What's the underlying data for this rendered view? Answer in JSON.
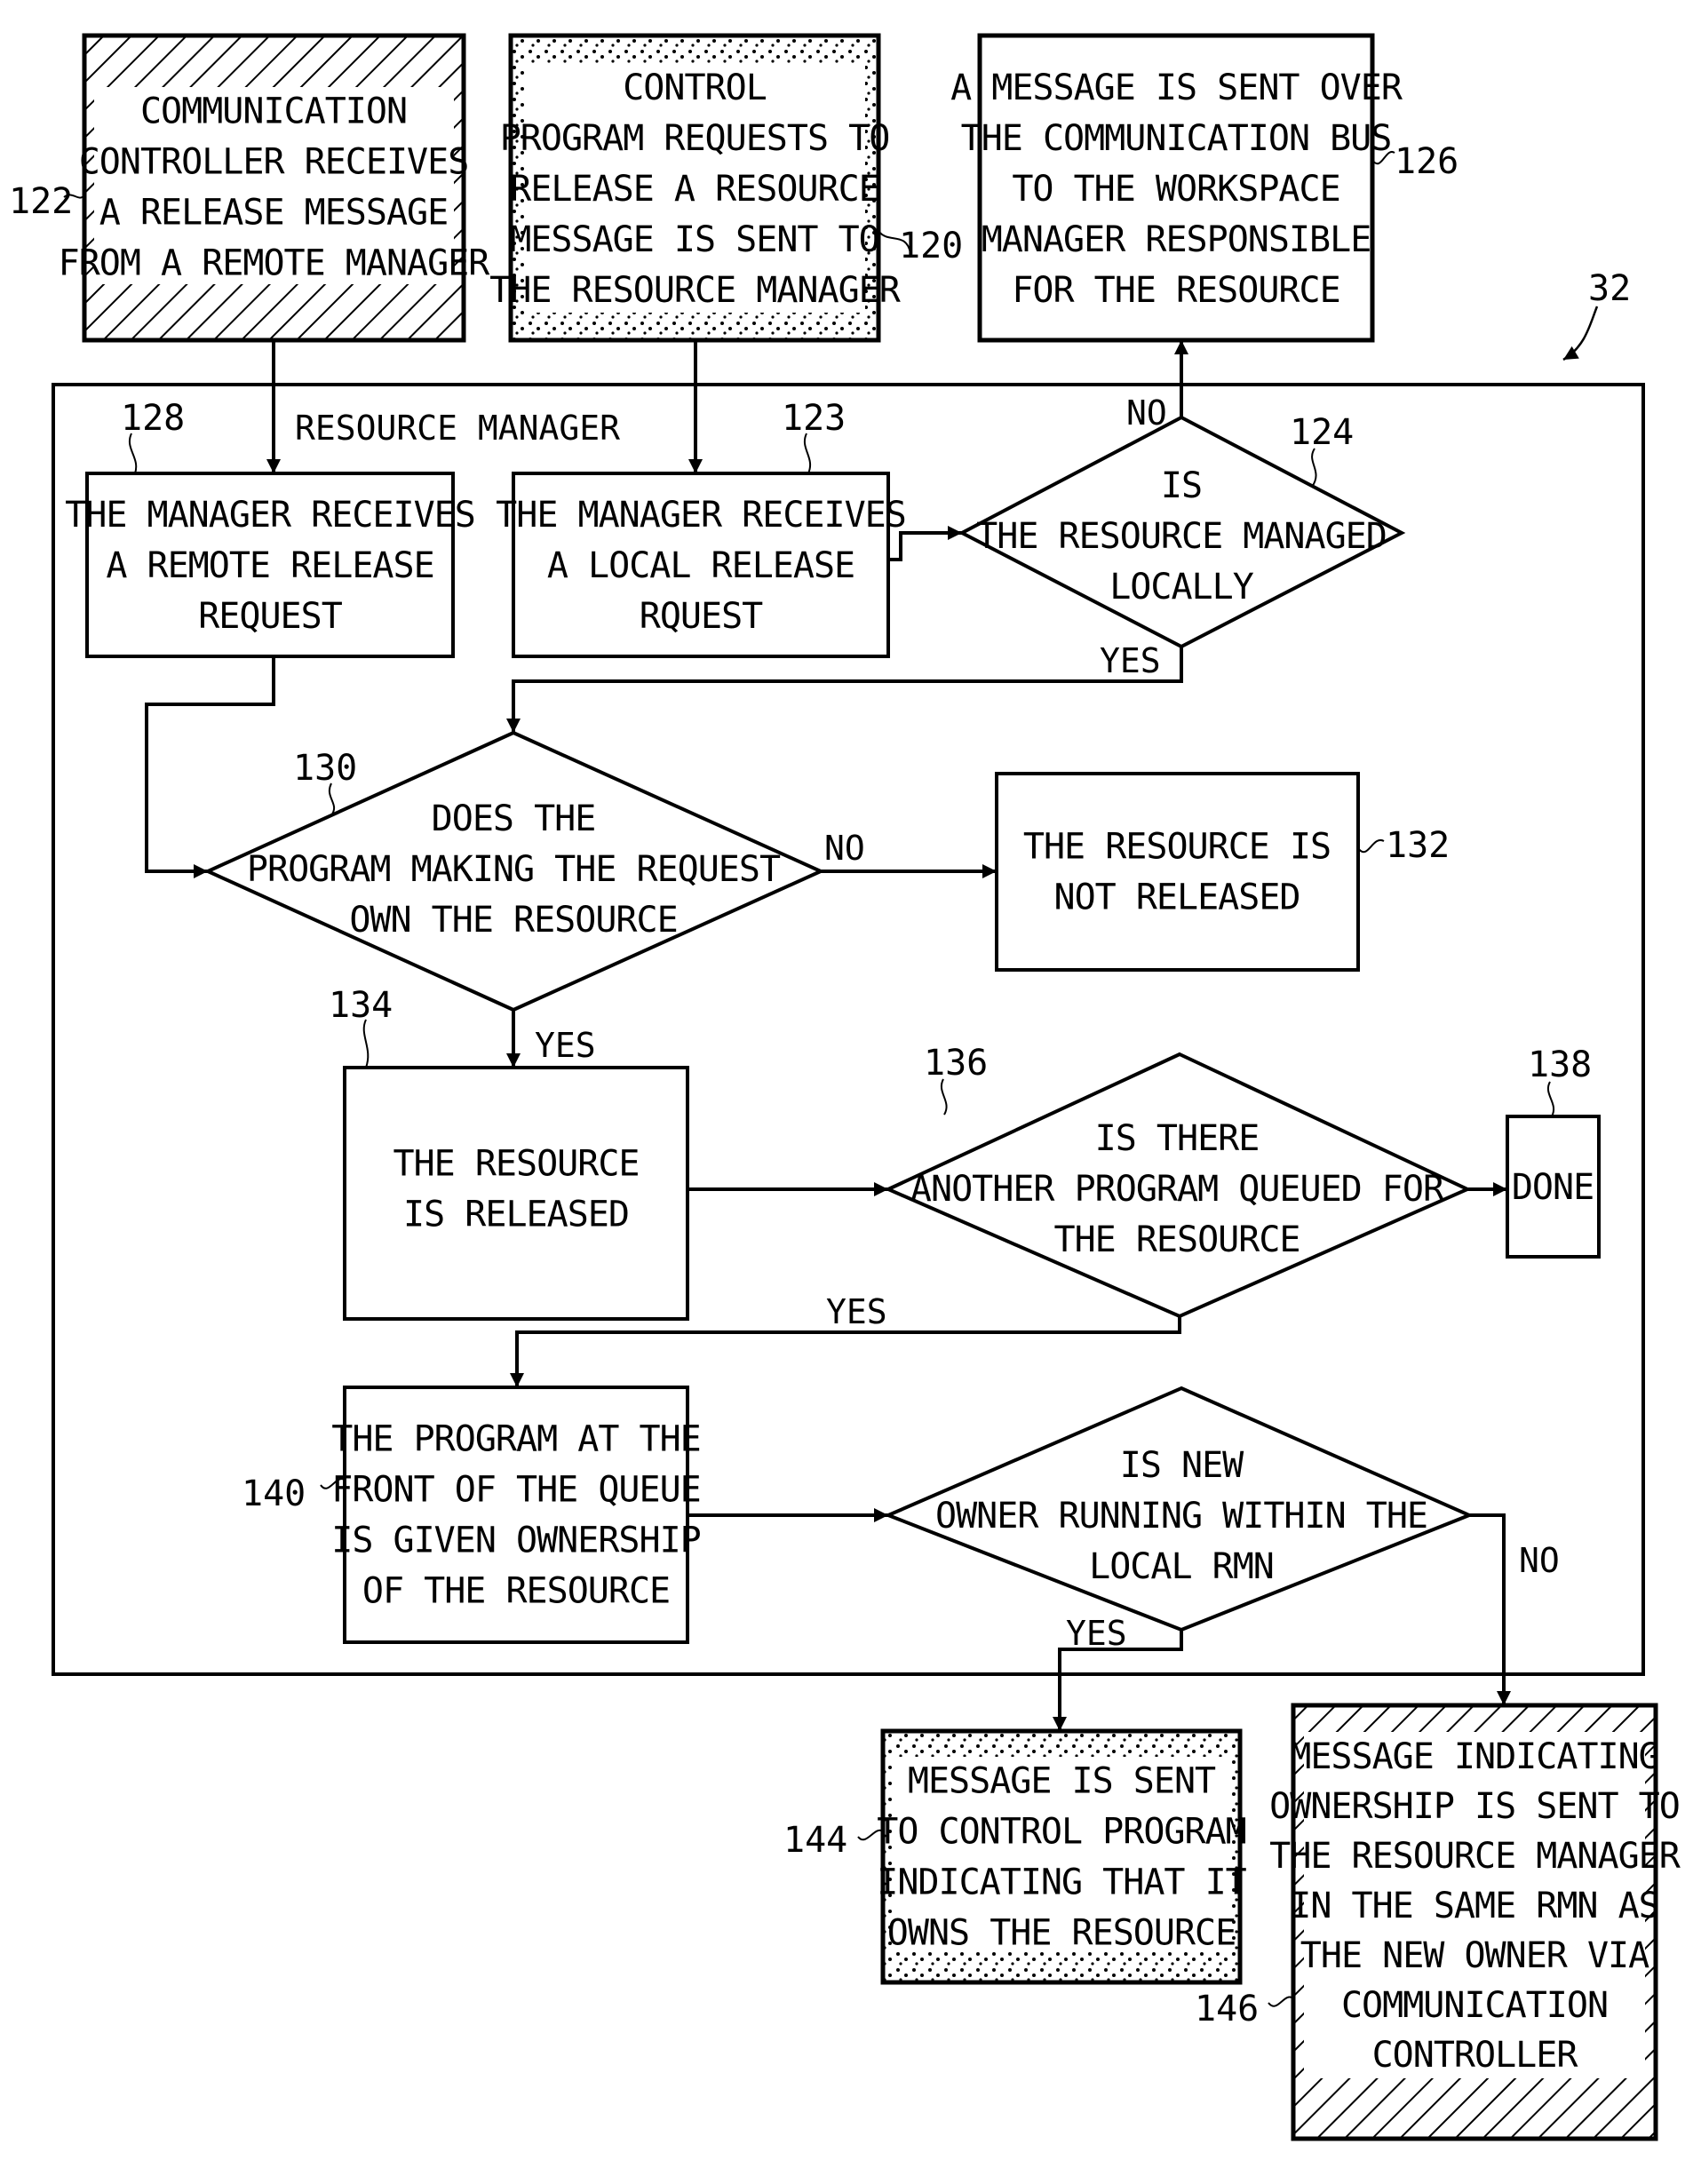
{
  "figure_ref": "32",
  "container": {
    "ref": "",
    "label": "RESOURCE MANAGER"
  },
  "nodes": [
    {
      "id": "122",
      "type": "process",
      "fill": "hatch",
      "ref": "122",
      "lines": [
        "COMMUNICATION",
        "CONTROLLER RECEIVES",
        "A RELEASE MESSAGE",
        "FROM A REMOTE MANAGER"
      ]
    },
    {
      "id": "120",
      "type": "process",
      "fill": "stipple",
      "ref": "120",
      "lines": [
        "CONTROL",
        "PROGRAM REQUESTS TO",
        "RELEASE A RESOURCE",
        "MESSAGE IS SENT TO",
        "THE RESOURCE MANAGER"
      ]
    },
    {
      "id": "126",
      "type": "process",
      "fill": "plain",
      "ref": "126",
      "lines": [
        "A MESSAGE IS SENT OVER",
        "THE COMMUNICATION BUS",
        "TO THE WORKSPACE",
        "MANAGER RESPONSIBLE",
        "FOR THE RESOURCE"
      ]
    },
    {
      "id": "128",
      "type": "process",
      "fill": "plain",
      "ref": "128",
      "lines": [
        "THE MANAGER RECEIVES",
        "A REMOTE RELEASE",
        "REQUEST"
      ]
    },
    {
      "id": "123",
      "type": "process",
      "fill": "plain",
      "ref": "123",
      "lines": [
        "THE MANAGER RECEIVES",
        "A LOCAL RELEASE",
        "RQUEST"
      ]
    },
    {
      "id": "124",
      "type": "decision",
      "ref": "124",
      "lines": [
        "IS",
        "THE RESOURCE MANAGED",
        "LOCALLY"
      ]
    },
    {
      "id": "130",
      "type": "decision",
      "ref": "130",
      "lines": [
        "DOES THE",
        "PROGRAM MAKING THE REQUEST",
        "OWN THE RESOURCE"
      ]
    },
    {
      "id": "132",
      "type": "process",
      "fill": "plain",
      "ref": "132",
      "lines": [
        "THE RESOURCE IS",
        "NOT RELEASED"
      ]
    },
    {
      "id": "134",
      "type": "process",
      "fill": "plain",
      "ref": "134",
      "lines": [
        "THE RESOURCE",
        "IS RELEASED"
      ]
    },
    {
      "id": "136",
      "type": "decision",
      "ref": "136",
      "lines": [
        "IS THERE",
        "ANOTHER PROGRAM QUEUED FOR",
        "THE RESOURCE"
      ]
    },
    {
      "id": "138",
      "type": "terminal",
      "fill": "plain",
      "ref": "138",
      "lines": [
        "DONE"
      ]
    },
    {
      "id": "140",
      "type": "process",
      "fill": "plain",
      "ref": "140",
      "lines": [
        "THE PROGRAM AT THE",
        "FRONT OF THE QUEUE",
        "IS GIVEN OWNERSHIP",
        "OF THE  RESOURCE"
      ]
    },
    {
      "id": "142",
      "type": "decision",
      "ref": "",
      "lines": [
        "IS NEW",
        "OWNER RUNNING WITHIN THE",
        "LOCAL RMN"
      ]
    },
    {
      "id": "144",
      "type": "process",
      "fill": "stipple",
      "ref": "144",
      "lines": [
        "MESSAGE IS SENT",
        "TO CONTROL PROGRAM",
        "INDICATING THAT IT",
        "OWNS THE RESOURCE"
      ]
    },
    {
      "id": "146",
      "type": "process",
      "fill": "hatch",
      "ref": "146",
      "lines": [
        "MESSAGE INDICATING",
        "OWNERSHIP IS SENT TO",
        "THE RESOURCE MANAGER",
        "IN THE SAME RMN AS",
        "THE NEW OWNER VIA",
        "COMMUNICATION",
        "CONTROLLER"
      ]
    }
  ],
  "edges": [
    {
      "from": "122",
      "to": "128",
      "label": ""
    },
    {
      "from": "120",
      "to": "123",
      "label": ""
    },
    {
      "from": "123",
      "to": "124",
      "label": ""
    },
    {
      "from": "124",
      "to": "126",
      "label": "NO"
    },
    {
      "from": "124",
      "to": "130",
      "label": "YES"
    },
    {
      "from": "128",
      "to": "130",
      "label": ""
    },
    {
      "from": "130",
      "to": "132",
      "label": "NO"
    },
    {
      "from": "130",
      "to": "134",
      "label": "YES"
    },
    {
      "from": "134",
      "to": "136",
      "label": ""
    },
    {
      "from": "136",
      "to": "138",
      "label": ""
    },
    {
      "from": "136",
      "to": "140",
      "label": "YES"
    },
    {
      "from": "140",
      "to": "142",
      "label": ""
    },
    {
      "from": "142",
      "to": "144",
      "label": "YES"
    },
    {
      "from": "142",
      "to": "146",
      "label": "NO"
    }
  ]
}
